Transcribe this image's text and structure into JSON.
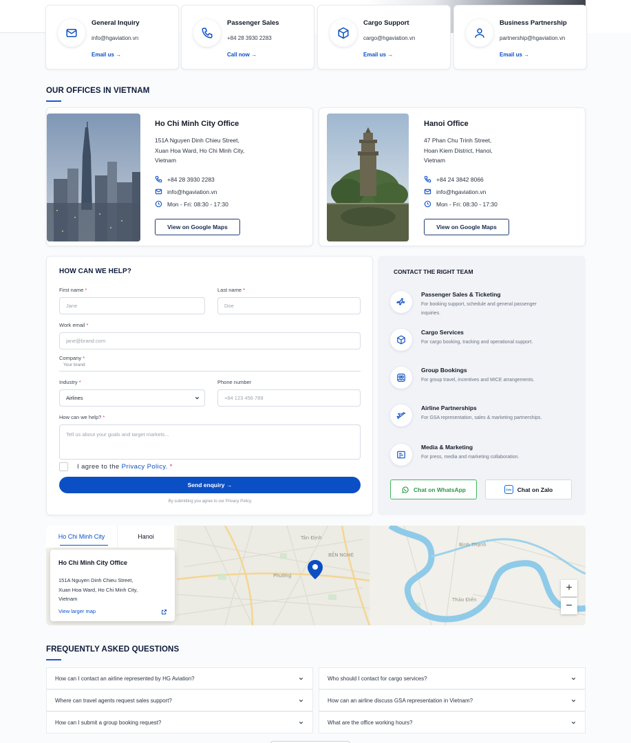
{
  "contacts": [
    {
      "title": "General Inquiry",
      "value": "info@hgaviation.vn",
      "link": "Email us →",
      "icon": "mail-icon"
    },
    {
      "title": "Passenger Sales",
      "value": "+84 28 3930 2283",
      "link": "Call now →",
      "icon": "phone-icon"
    },
    {
      "title": "Cargo Support",
      "value": "cargo@hgaviation.vn",
      "link": "Email us →",
      "icon": "box-icon"
    },
    {
      "title": "Business Partnership",
      "value": "partnership@hgaviation.vn",
      "link": "Email us →",
      "icon": "user-icon"
    }
  ],
  "offices_section": {
    "title": "OUR OFFICES IN VIETNAM"
  },
  "offices": [
    {
      "name": "Ho Chi Minh City Office",
      "address": "151A Nguyen Dinh Chieu Street,\nXuan Hoa Ward, Ho Chi Minh City,\nVietnam",
      "phone": "+84 28 3930 2283",
      "email": "info@hgaviation.vn",
      "hours": "Mon - Fri: 08:30 - 17:30",
      "button": "View on Google Maps"
    },
    {
      "name": "Hanoi Office",
      "address": "47 Phan Chu Trinh Street,\nHoan Kiem District, Hanoi,\nVietnam",
      "phone": "+84 24 3842 8066",
      "email": "info@hgaviation.vn",
      "hours": "Mon - Fri: 08:30 - 17:30",
      "button": "View on Google Maps"
    }
  ],
  "form": {
    "title": "HOW CAN WE HELP?",
    "first_name_label": "First name",
    "first_name_placeholder": "Jane",
    "last_name_label": "Last name",
    "last_name_placeholder": "Doe",
    "email_label": "Work email",
    "email_placeholder": "jane@brand.com",
    "company_label": "Company",
    "company_placeholder": "Your brand",
    "industry_label": "Industry",
    "industry_value": "Airlines",
    "phone_label": "Phone number",
    "phone_placeholder": "+84 123 456 789",
    "help_label": "How can we help?",
    "help_placeholder": "Tell us about your goals and target markets...",
    "agree_prefix": "I agree to the",
    "privacy_link": "Privacy Policy.",
    "required_mark": "*",
    "send_label": "Send enquiry →",
    "footnote": "By submitting you agree to our Privacy Policy."
  },
  "team": {
    "title": "CONTACT THE RIGHT TEAM",
    "items": [
      {
        "title": "Passenger Sales & Ticketing",
        "desc": "For booking support, schedule and general passenger inquiries.",
        "icon": "plane-icon"
      },
      {
        "title": "Cargo Services",
        "desc": "For cargo booking, tracking and operational support.",
        "icon": "box-icon"
      },
      {
        "title": "Group Bookings",
        "desc": "For group travel, incentives and MICE arrangements.",
        "icon": "group-icon"
      },
      {
        "title": "Airline Partnerships",
        "desc": "For GSA representation, sales & marketing partnerships.",
        "icon": "plane-takeoff-icon"
      },
      {
        "title": "Media & Marketing",
        "desc": "For press, media and marketing collaboration.",
        "icon": "media-icon"
      }
    ],
    "whatsapp_label": "Chat on WhatsApp",
    "zalo_label": "Chat on Zalo",
    "zalo_badge": "Zalo"
  },
  "map": {
    "tabs": [
      "Ho Chi Minh City",
      "Hanoi"
    ],
    "active_tab": 0,
    "info_title": "Ho Chi Minh City Office",
    "info_address": "151A Nguyen Dinh Chieu Street,\nXuan Hoa Ward, Ho Chi Minh City,\nVietnam",
    "info_link": "View larger map",
    "zoom_in": "+",
    "zoom_out": "−"
  },
  "faq": {
    "title": "FREQUENTLY ASKED QUESTIONS",
    "items": [
      "How can I contact an airline represented by HG Aviation?",
      "Who should I contact for cargo services?",
      "Where can travel agents request sales support?",
      "How can an airline discuss GSA representation in Vietnam?",
      "How can I submit a group booking request?",
      "What are the office working hours?"
    ]
  },
  "colors": {
    "accent": "#0b4fc4",
    "navy": "#0d1a3a",
    "whatsapp": "#25a244"
  }
}
